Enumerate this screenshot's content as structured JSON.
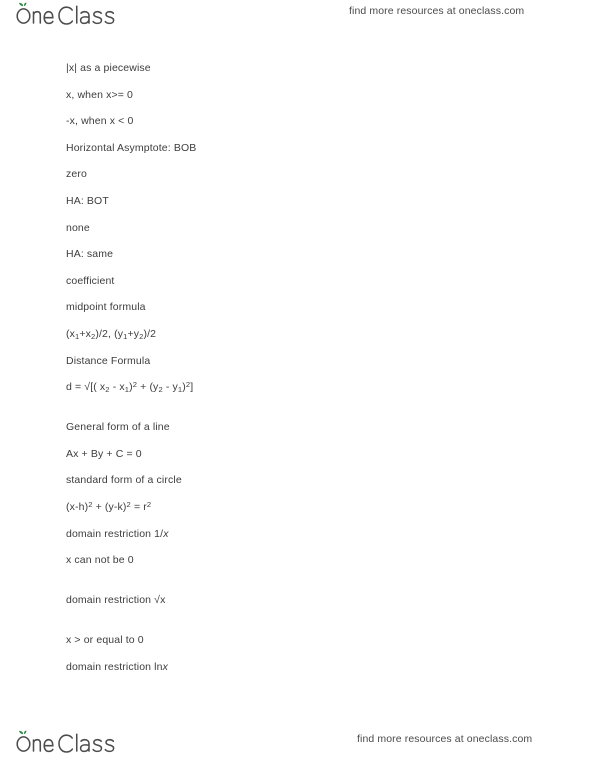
{
  "header": {
    "logo_text": "OneClass",
    "logo_icon": "sprout-leaf-icon",
    "logo_leaf_color": "#2e8b47",
    "logo_text_color": "#4d4d4d",
    "tagline": "find more resources at oneclass.com"
  },
  "footer": {
    "logo_text": "OneClass",
    "logo_icon": "sprout-leaf-icon",
    "tagline": "find more resources at oneclass.com"
  },
  "notes": {
    "lines": [
      {
        "id": "abs-piecewise",
        "text": "|x| as a piecewise"
      },
      {
        "id": "piecewise-positive",
        "text": "x, when x>= 0"
      },
      {
        "id": "piecewise-negative",
        "text": "-x, when x < 0"
      },
      {
        "id": "horizontal-asymptote-bob",
        "text": "Horizontal Asymptote: BOB"
      },
      {
        "id": "bob-answer",
        "text": "zero"
      },
      {
        "id": "ha-bot",
        "text": "HA: BOT"
      },
      {
        "id": "bot-answer",
        "text": "none"
      },
      {
        "id": "ha-same",
        "text": "HA: same"
      },
      {
        "id": "same-answer",
        "text": "coefficient"
      },
      {
        "id": "midpoint-formula-label",
        "text": "midpoint formula"
      },
      {
        "id": "midpoint-formula",
        "text": "(x1+x2)/2, (y1+y2)/2"
      },
      {
        "id": "distance-formula-label",
        "text": "Distance Formula"
      },
      {
        "id": "distance-formula",
        "text": "d = √[( x2 - x1)² + (y2 - y1)²]"
      },
      {
        "id": "general-form-line-label",
        "text": "General form of a line"
      },
      {
        "id": "general-form-line",
        "text": "Ax + By + C = 0"
      },
      {
        "id": "standard-form-circle-label",
        "text": "standard form of a circle"
      },
      {
        "id": "standard-form-circle",
        "text": "(x-h)² + (y-k)² = r²"
      },
      {
        "id": "domain-restriction-reciprocal-label",
        "text": "domain restriction 1/x"
      },
      {
        "id": "domain-restriction-reciprocal",
        "text": "x can not be 0"
      },
      {
        "id": "domain-restriction-sqrt-label",
        "text": "domain restriction √x"
      },
      {
        "id": "domain-restriction-sqrt",
        "text": "x > or equal to 0"
      },
      {
        "id": "domain-restriction-ln-label",
        "text": "domain restriction lnx"
      }
    ]
  }
}
